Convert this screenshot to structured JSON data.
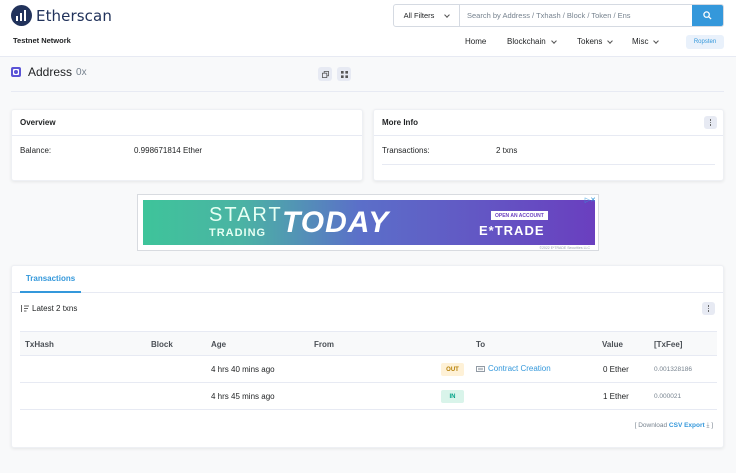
{
  "brand": {
    "name": "Etherscan"
  },
  "network_label": "Testnet Network",
  "search": {
    "filter_label": "All Filters",
    "placeholder": "Search by Address / Txhash / Block / Token / Ens"
  },
  "nav": {
    "home": "Home",
    "blockchain": "Blockchain",
    "tokens": "Tokens",
    "misc": "Misc",
    "network_badge": "Ropsten"
  },
  "address": {
    "title": "Address",
    "hash": "0x"
  },
  "overview": {
    "title": "Overview",
    "balance_label": "Balance:",
    "balance_value": "0.998671814 Ether"
  },
  "more_info": {
    "title": "More Info",
    "transactions_label": "Transactions:",
    "transactions_value": "2 txns"
  },
  "ad": {
    "start": "START",
    "trading": "TRADING",
    "today": "TODAY",
    "open_account": "OPEN AN ACCOUNT",
    "brand": "E*TRADE",
    "fineprint": "©2022 E*TRADE Securities LLC"
  },
  "transactions": {
    "tab_label": "Transactions",
    "latest_label": "Latest 2 txns",
    "columns": {
      "txhash": "TxHash",
      "block": "Block",
      "age": "Age",
      "from": "From",
      "to": "To",
      "value": "Value",
      "txfee": "[TxFee]"
    },
    "rows": [
      {
        "age": "4 hrs 40 mins ago",
        "direction": "OUT",
        "to": "Contract Creation",
        "value": "0 Ether",
        "fee": "0.001328186"
      },
      {
        "age": "4 hrs 45 mins ago",
        "direction": "IN",
        "to": "",
        "value": "1 Ether",
        "fee": "0.000021"
      }
    ],
    "download_prefix": "[ Download",
    "csv_export": "CSV Export",
    "download_suffix": "]"
  },
  "colors": {
    "accent": "#3498db",
    "brand_dark": "#21325b"
  }
}
